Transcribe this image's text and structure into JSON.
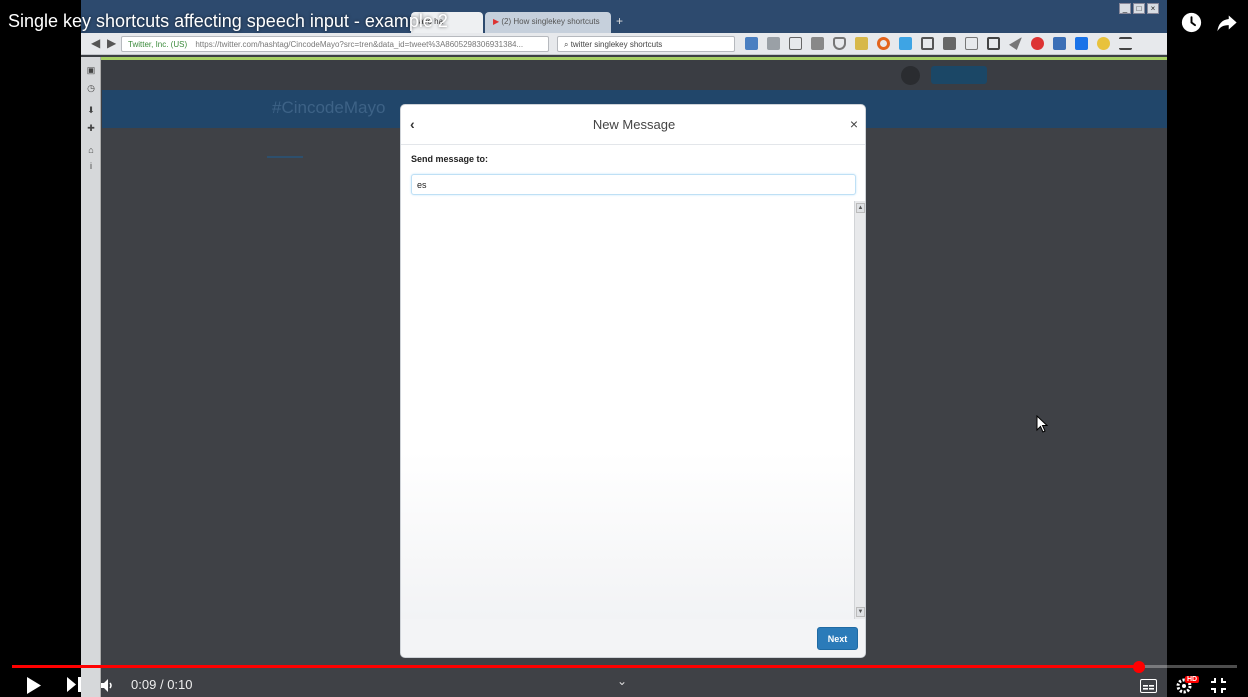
{
  "video": {
    "title": "Single key shortcuts affecting speech input - example 2",
    "current_time": "0:09",
    "separator": "/",
    "duration": "0:10",
    "progress": 0.92,
    "hd_badge": "HD"
  },
  "browser": {
    "tabs": [
      {
        "label": "ayo ha"
      },
      {
        "label": "(2) How singlekey shortcuts"
      }
    ],
    "new_tab": "+",
    "url": {
      "site_identity": "Twitter, Inc. (US)",
      "address": "https://twitter.com/hashtag/CincodeMayo?src=tren&data_id=tweet%3A8605298306931384..."
    },
    "search_text": "twitter singlekey shortcuts"
  },
  "twitter_page": {
    "hashtag": "#CincodeMayo"
  },
  "modal": {
    "title": "New Message",
    "back_icon": "‹",
    "close_icon": "×",
    "send_label": "Send message to:",
    "recipient_value": "es",
    "next_label": "Next"
  },
  "colors": {
    "progress": "#ff0000",
    "twitter_blue": "#2b7bb9",
    "green_bar": "#a6cf64"
  },
  "icons": [
    "watch-later-icon",
    "share-icon",
    "play-icon",
    "next-icon",
    "volume-icon",
    "chevron-down-icon",
    "subtitles-icon",
    "settings-icon",
    "fullscreen-exit-icon"
  ]
}
